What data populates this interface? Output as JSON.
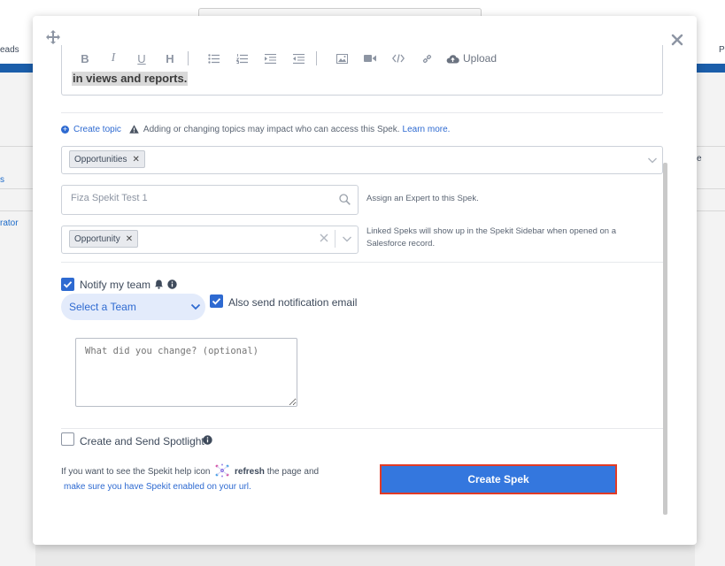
{
  "background": {
    "nav_left_label": "eads",
    "nav_right_label": "P",
    "list_link_1": "s",
    "list_link_2": "rator",
    "right_col_label": "e"
  },
  "toolbar": {
    "bold": "B",
    "italic": "I",
    "underline": "U",
    "heading": "H",
    "upload_label": "Upload"
  },
  "editor": {
    "visible_text": "in views and reports."
  },
  "topics": {
    "create_topic_label": "Create topic",
    "warning_text": "Adding or changing topics may impact who can access this Spek.",
    "learn_more_label": "Learn more.",
    "selected_topic": "Opportunities"
  },
  "expert": {
    "value": "Fiza Spekit Test 1",
    "hint": "Assign an Expert to this Spek."
  },
  "linked": {
    "selected_object": "Opportunity",
    "hint_line1": "Linked Speks will show up in the Spekit Sidebar when opened on a",
    "hint_line2": "Salesforce record."
  },
  "notify": {
    "label": "Notify my team",
    "checked": true,
    "team_placeholder": "Select a Team",
    "email_label": "Also send notification email",
    "email_checked": true,
    "change_placeholder": "What did you change? (optional)"
  },
  "spotlight": {
    "label": "Create and Send Spotlight",
    "checked": false
  },
  "help": {
    "line1_pre": "If you want to see the Spekit help icon",
    "line1_bold": "refresh",
    "line1_post": "the page and",
    "line2_link": "make sure you have Spekit enabled on your url."
  },
  "actions": {
    "create_label": "Create Spek"
  },
  "colors": {
    "accent": "#3477de",
    "button_outline": "#e23b25",
    "link": "#2e6ad1",
    "app_bar": "#1b5eaa"
  }
}
